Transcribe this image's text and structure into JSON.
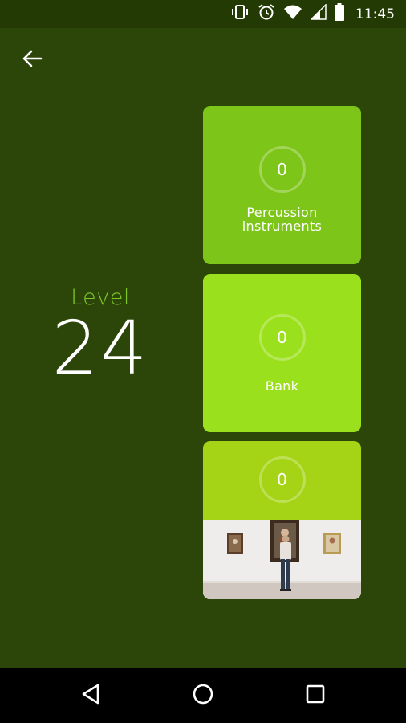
{
  "status_bar": {
    "time": "11:45",
    "icons": [
      "vibrate-icon",
      "alarm-icon",
      "wifi-icon",
      "signal-icon",
      "battery-icon"
    ]
  },
  "header": {
    "back_icon": "arrow-left-icon"
  },
  "level": {
    "label": "Level",
    "number": "24"
  },
  "cards": [
    {
      "score": "0",
      "title_line1": "Percussion",
      "title_line2": "instruments",
      "color": "#7ec51a"
    },
    {
      "score": "0",
      "title_line1": "Bank",
      "title_line2": "",
      "color": "#9be01c"
    },
    {
      "score": "0",
      "image": "museum-gallery-photo",
      "color": "#a5d416"
    }
  ],
  "colors": {
    "background": "#2c4609",
    "status_bar": "#233a05",
    "level_label": "#7ec628"
  },
  "nav_bar": {
    "buttons": [
      "back-triangle-icon",
      "home-circle-icon",
      "recents-square-icon"
    ]
  }
}
